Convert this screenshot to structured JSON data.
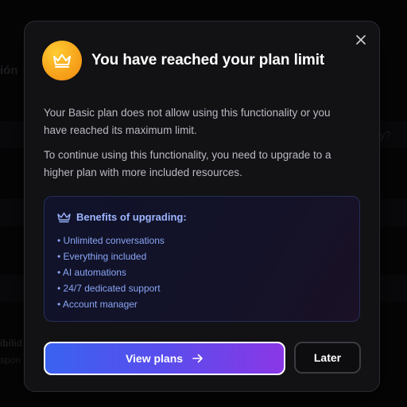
{
  "background": {
    "frag_left": "ión",
    "frag_right": "y?",
    "frag_bottom1": "ibilid",
    "frag_bottom2": "spon"
  },
  "modal": {
    "title": "You have reached your plan limit",
    "title_icon": "crown-icon",
    "close_icon": "close-icon",
    "paragraph1": "Your Basic plan does not allow using this functionality or you have reached its maximum limit.",
    "paragraph2": "To continue using this functionality, you need to upgrade to a higher plan with more included resources.",
    "benefits": {
      "title": "Benefits of upgrading:",
      "items": [
        "• Unlimited conversations",
        "• Everything included",
        "• AI automations",
        "• 24/7 dedicated support",
        "• Account manager"
      ]
    },
    "primary_button": "View plans",
    "secondary_button": "Later"
  },
  "colors": {
    "accent_gradient_start": "#3a62f0",
    "accent_gradient_end": "#8a37e6",
    "icon_gold": "#f7a21b",
    "benefit_text": "#8aa6f5"
  }
}
